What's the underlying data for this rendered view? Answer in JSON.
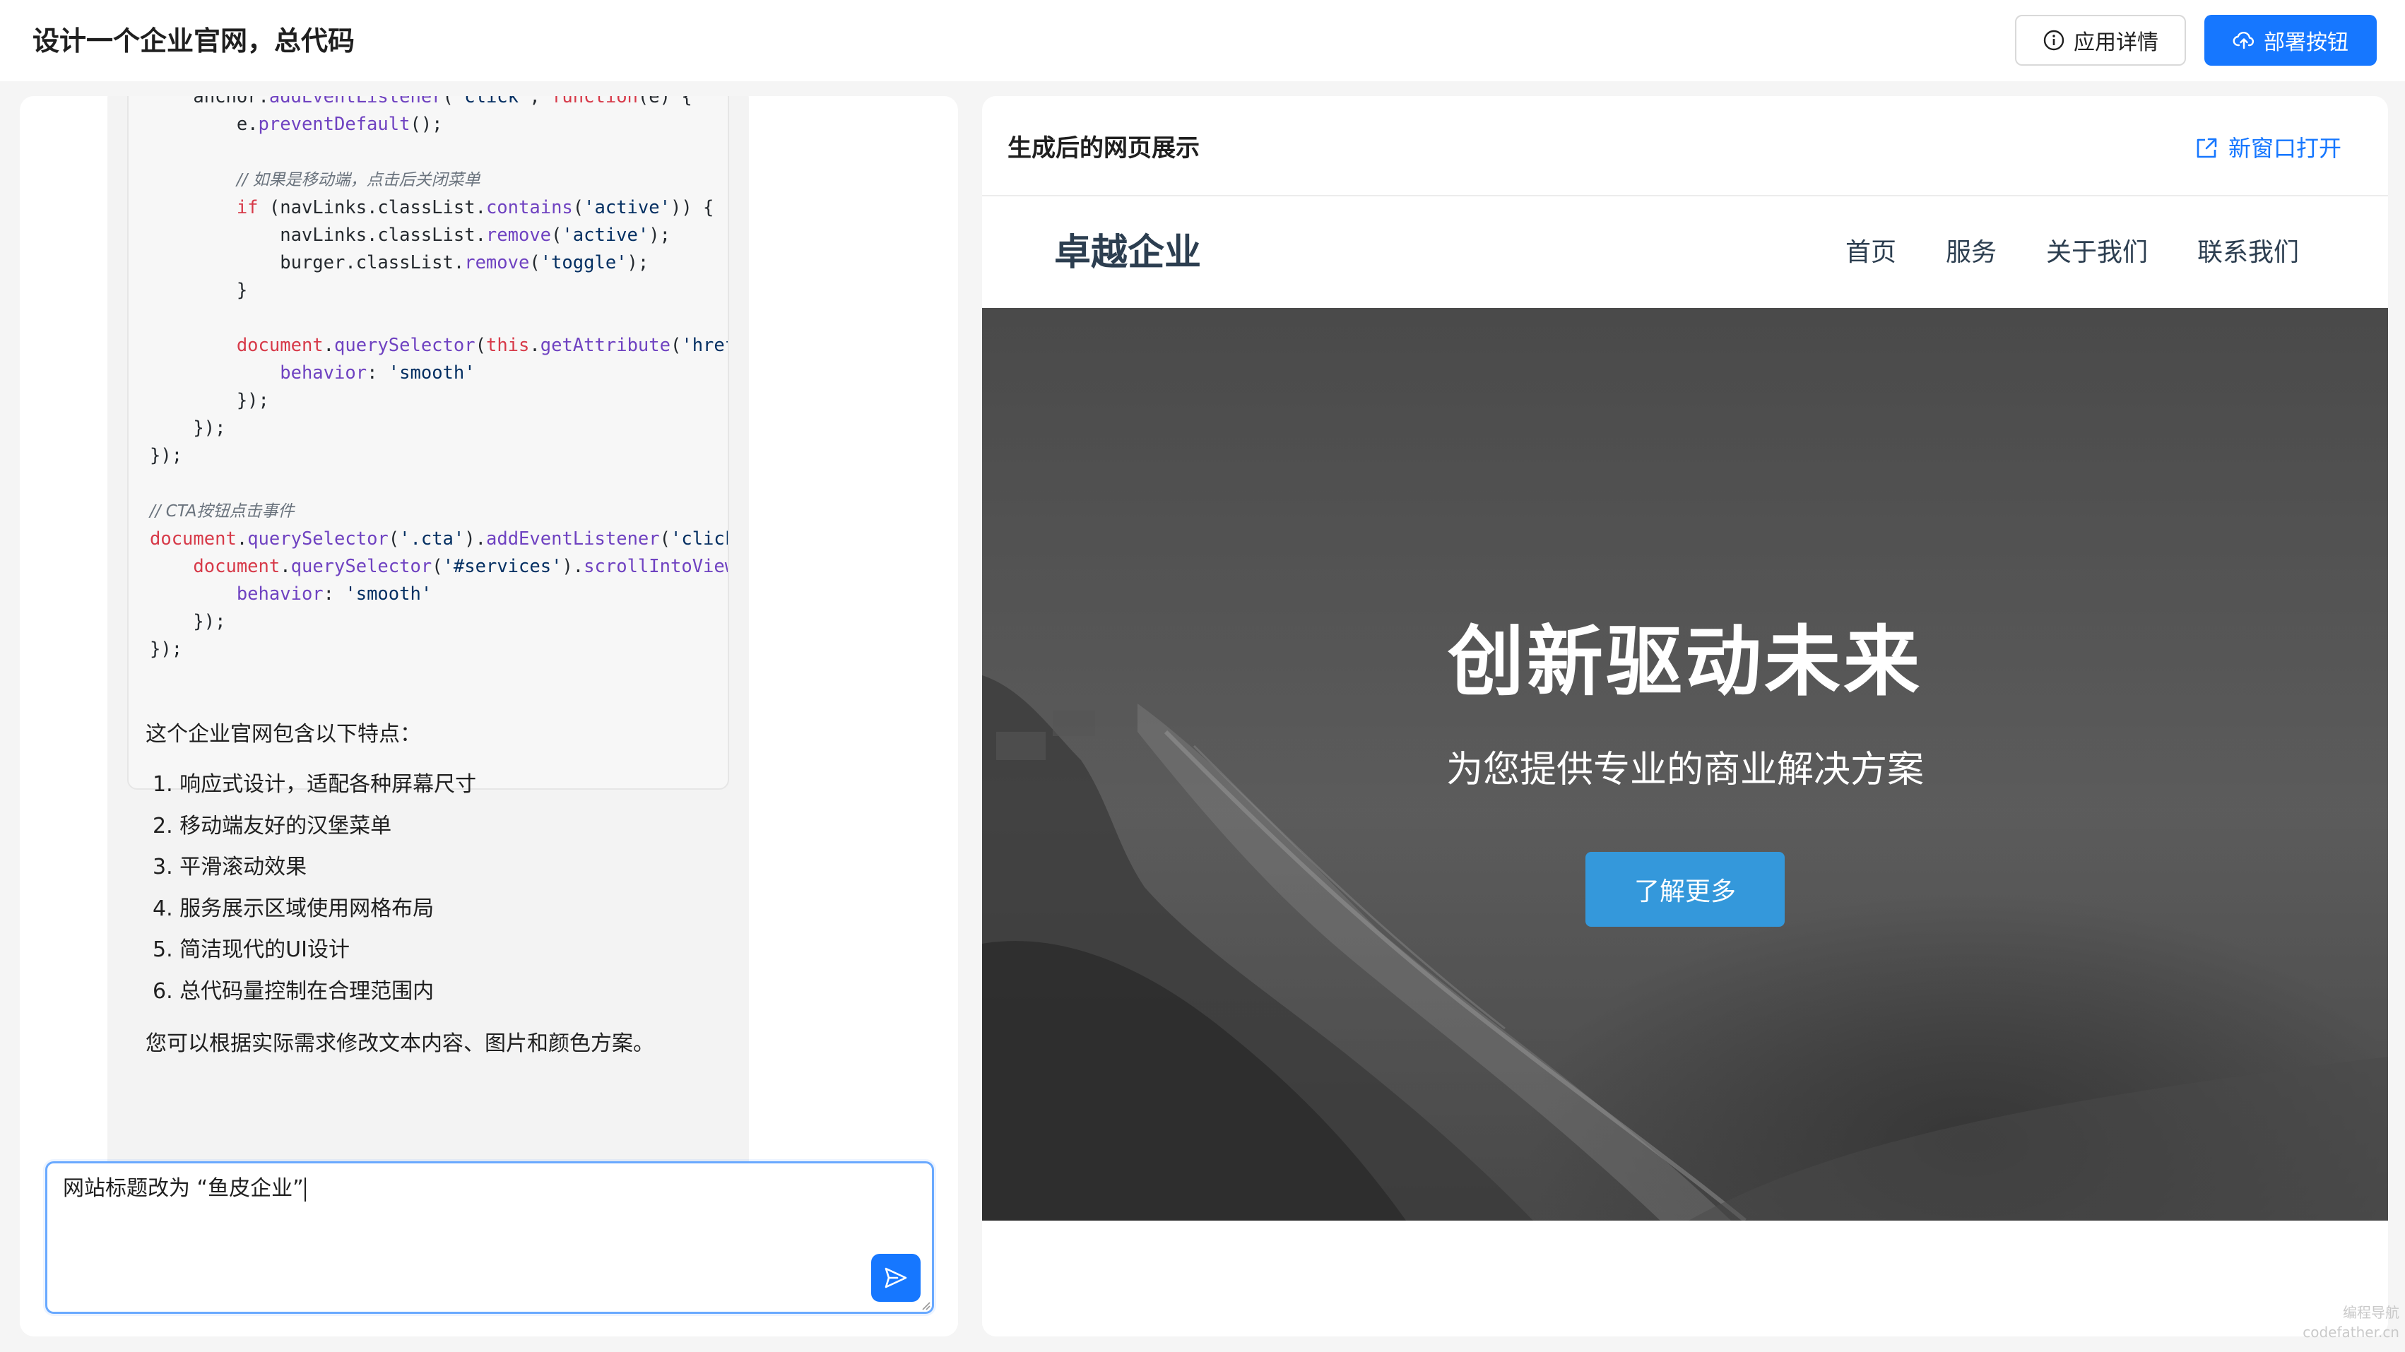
{
  "header": {
    "title": "设计一个企业官网，总代码",
    "detail_button": "应用详情",
    "deploy_button": "部署按钮"
  },
  "chat": {
    "code_lines": [
      "    anchor.addEventListener('click', function(e) {",
      "        e.preventDefault();",
      "",
      "        // 如果是移动端，点击后关闭菜单",
      "        if (navLinks.classList.contains('active')) {",
      "            navLinks.classList.remove('active');",
      "            burger.classList.remove('toggle');",
      "        }",
      "",
      "        document.querySelector(this.getAttribute('href",
      "            behavior: 'smooth'",
      "        });",
      "    });",
      "});",
      "",
      "// CTA按钮点击事件",
      "document.querySelector('.cta').addEventListener('click",
      "    document.querySelector('#services').scrollIntoView",
      "        behavior: 'smooth'",
      "    });",
      "});"
    ],
    "features_intro": "这个企业官网包含以下特点：",
    "features": [
      "1. 响应式设计，适配各种屏幕尺寸",
      "2. 移动端友好的汉堡菜单",
      "3. 平滑滚动效果",
      "4. 服务展示区域使用网格布局",
      "5. 简洁现代的UI设计",
      "6. 总代码量控制在合理范围内"
    ],
    "closing": "您可以根据实际需求修改文本内容、图片和颜色方案。",
    "input_value": "网站标题改为 “鱼皮企业”"
  },
  "preview_panel": {
    "title": "生成后的网页展示",
    "open_new_window": "新窗口打开"
  },
  "site": {
    "logo": "卓越企业",
    "nav": [
      "首页",
      "服务",
      "关于我们",
      "联系我们"
    ],
    "hero_title": "创新驱动未来",
    "hero_subtitle": "为您提供专业的商业解决方案",
    "hero_button": "了解更多"
  },
  "watermark": {
    "line1": "编程导航",
    "line2": "codefather.cn"
  },
  "colors": {
    "primary": "#1677ff",
    "hero_button": "#3498db",
    "logo_text": "#2c3e50"
  }
}
